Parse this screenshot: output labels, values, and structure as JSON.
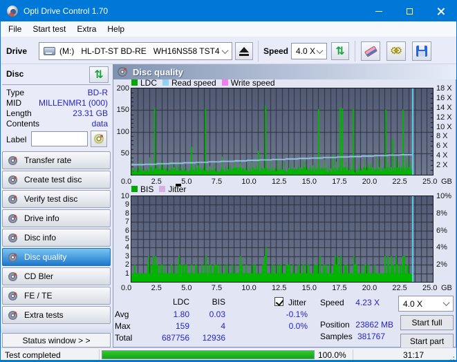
{
  "window": {
    "title": "Opti Drive Control 1.70"
  },
  "menu": {
    "items": [
      "File",
      "Start test",
      "Extra",
      "Help"
    ]
  },
  "toolbar": {
    "drive_label": "Drive",
    "drive_value": "(M:)   HL-DT-ST BD-RE   WH16NS58 TST4",
    "speed_label": "Speed",
    "speed_value": "4.0 X"
  },
  "disc_panel": {
    "title": "Disc",
    "rows": [
      {
        "label": "Type",
        "value": "BD-R"
      },
      {
        "label": "MID",
        "value": "MILLENMR1 (000)"
      },
      {
        "label": "Length",
        "value": "23.31 GB"
      },
      {
        "label": "Contents",
        "value": "data"
      }
    ],
    "label_field": {
      "label": "Label",
      "value": ""
    }
  },
  "sidebar": {
    "items": [
      {
        "label": "Transfer rate",
        "active": false
      },
      {
        "label": "Create test disc",
        "active": false
      },
      {
        "label": "Verify test disc",
        "active": false
      },
      {
        "label": "Drive info",
        "active": false
      },
      {
        "label": "Disc info",
        "active": false
      },
      {
        "label": "Disc quality",
        "active": true
      },
      {
        "label": "CD Bler",
        "active": false
      },
      {
        "label": "FE / TE",
        "active": false
      },
      {
        "label": "Extra tests",
        "active": false
      }
    ],
    "status_window_label": "Status window > >"
  },
  "main": {
    "header": "Disc quality"
  },
  "stats": {
    "columns": [
      "LDC",
      "BIS"
    ],
    "rows": [
      {
        "label": "Avg",
        "ldc": "1.80",
        "bis": "0.03",
        "jitter": "-0.1%"
      },
      {
        "label": "Max",
        "ldc": "159",
        "bis": "4",
        "jitter": "0.0%"
      },
      {
        "label": "Total",
        "ldc": "687756",
        "bis": "12936",
        "jitter": ""
      }
    ],
    "jitter_label": "Jitter",
    "jitter_checked": true,
    "speed_label": "Speed",
    "speed_value": "4.23 X",
    "position_label": "Position",
    "position_value": "23862 MB",
    "samples_label": "Samples",
    "samples_value": "381767",
    "speed_select": "4.0 X",
    "start_full_label": "Start full",
    "start_part_label": "Start part"
  },
  "statusbar": {
    "status": "Test completed",
    "progress_percent": 100,
    "progress_label": "100.0%",
    "time": "31:17"
  },
  "colors": {
    "accent": "#0078d7",
    "chart_green": "#00b400",
    "read_blue": "#9bd7f5",
    "write_pink": "#f27df2",
    "jitter_pink": "#d9aee0",
    "value_blue": "#2323cb",
    "end_marker": "#5fd2f0",
    "plot_bg_top": "#515a73",
    "plot_bg_bottom": "#6f7990",
    "grid": "#2c3140"
  },
  "chart_data": [
    {
      "type": "bar",
      "title": "LDC / Read speed / Write speed",
      "legend": [
        {
          "label": "LDC",
          "color": "#00a800"
        },
        {
          "label": "Read speed",
          "color": "#8fd2f2"
        },
        {
          "label": "Write speed",
          "color": "#f27df2"
        }
      ],
      "x_axis": {
        "ticks": [
          "0.0",
          "2.5",
          "5.0",
          "7.5",
          "10.0",
          "12.5",
          "15.0",
          "17.5",
          "20.0",
          "22.5",
          "25.0"
        ],
        "unit": "GB",
        "range_gb": [
          0,
          25
        ],
        "minor_step_gb": 0.5
      },
      "y_left": {
        "ticks": [
          200,
          150,
          100,
          50
        ],
        "range": [
          0,
          200
        ],
        "minor_step": 10
      },
      "y_right": {
        "ticks": [
          "18 X",
          "16 X",
          "14 X",
          "12 X",
          "10 X",
          "8 X",
          "6 X",
          "4 X",
          "2 X"
        ],
        "range_x": [
          0,
          18
        ]
      },
      "data_end_gb": 23.35,
      "series": {
        "ldc_baseline_units": [
          6,
          18
        ],
        "ldc_major_spikes": [
          [
            1.9,
            155
          ],
          [
            4.95,
            65
          ],
          [
            6.1,
            154
          ],
          [
            10.5,
            56
          ],
          [
            11.05,
            160
          ],
          [
            15.5,
            152
          ],
          [
            17.25,
            157
          ],
          [
            17.45,
            154
          ],
          [
            18.35,
            153
          ],
          [
            21.05,
            151
          ],
          [
            21.6,
            83
          ],
          [
            22.5,
            151
          ]
        ],
        "ldc_medium_spikes": [
          [
            0.75,
            35
          ],
          [
            1.5,
            40
          ],
          [
            2.2,
            22
          ],
          [
            2.6,
            28
          ],
          [
            3.25,
            30
          ],
          [
            3.6,
            20
          ],
          [
            3.85,
            28
          ],
          [
            4.3,
            22
          ],
          [
            5.0,
            25
          ],
          [
            5.5,
            22
          ],
          [
            6.5,
            20
          ],
          [
            6.85,
            25
          ],
          [
            7.5,
            42
          ],
          [
            7.8,
            20
          ],
          [
            8.2,
            22
          ],
          [
            8.6,
            18
          ],
          [
            9.0,
            28
          ],
          [
            9.6,
            25
          ],
          [
            10.0,
            30
          ],
          [
            10.3,
            22
          ],
          [
            11.5,
            35
          ],
          [
            12.1,
            40
          ],
          [
            12.4,
            25
          ],
          [
            12.65,
            30
          ],
          [
            13.2,
            28
          ],
          [
            13.8,
            25
          ],
          [
            14.4,
            30
          ],
          [
            14.8,
            22
          ],
          [
            15.2,
            28
          ],
          [
            16.0,
            35
          ],
          [
            16.35,
            25
          ],
          [
            16.6,
            45
          ],
          [
            16.8,
            45
          ],
          [
            17.0,
            30
          ],
          [
            17.8,
            30
          ],
          [
            18.1,
            25
          ],
          [
            18.8,
            28
          ],
          [
            19.3,
            35
          ],
          [
            19.6,
            25
          ],
          [
            19.9,
            30
          ],
          [
            20.3,
            40
          ],
          [
            20.6,
            35
          ],
          [
            21.3,
            30
          ],
          [
            21.9,
            45
          ],
          [
            22.2,
            30
          ],
          [
            22.8,
            40
          ],
          [
            23.1,
            32
          ]
        ],
        "read_speed_x": {
          "start": 2.05,
          "end": 4.25
        }
      }
    },
    {
      "type": "bar",
      "title": "BIS / Jitter",
      "legend": [
        {
          "label": "BIS",
          "color": "#00a800"
        },
        {
          "label": "Jitter",
          "color": "#d9aee0"
        }
      ],
      "x_axis": {
        "ticks": [
          "0.0",
          "2.5",
          "5.0",
          "7.5",
          "10.0",
          "12.5",
          "15.0",
          "17.5",
          "20.0",
          "22.5",
          "25.0"
        ],
        "unit": "GB",
        "range_gb": [
          0,
          25
        ],
        "minor_step_gb": 0.5
      },
      "y_left": {
        "ticks": [
          10,
          9,
          8,
          7,
          6,
          5,
          4,
          3,
          2,
          1
        ],
        "range": [
          0,
          10
        ]
      },
      "y_right": {
        "ticks": [
          "10%",
          "8%",
          "6%",
          "4%",
          "2%"
        ],
        "range_pct": [
          0,
          10
        ]
      },
      "data_end_gb": 23.35,
      "series": {
        "bis_baseline": 1,
        "bis_spikes_2_count": 140,
        "bis_spikes_3_gb": [
          1.35,
          1.75,
          1.95,
          3.9,
          6.15,
          9.0,
          11.0,
          15.6,
          16.85,
          17.05,
          17.3,
          18.4,
          21.0,
          21.2,
          21.5,
          21.9,
          22.5,
          22.6
        ],
        "bis_spike_4": [
          11.1,
          4
        ]
      }
    }
  ]
}
